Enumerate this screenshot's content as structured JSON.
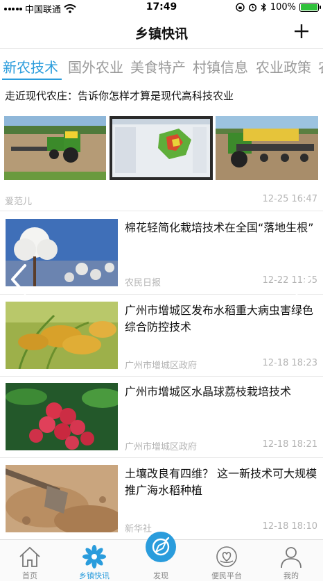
{
  "status_bar": {
    "carrier": "中国联通",
    "time": "17:49",
    "battery": "100%",
    "battery_level": 1.0
  },
  "header": {
    "title": "乡镇快讯",
    "add_icon": "plus-icon"
  },
  "tabs": [
    {
      "label": "新农技术",
      "active": true
    },
    {
      "label": "国外农业",
      "active": false
    },
    {
      "label": "美食特产",
      "active": false
    },
    {
      "label": "村镇信息",
      "active": false
    },
    {
      "label": "农业政策",
      "active": false
    },
    {
      "label": "农",
      "active": false
    }
  ],
  "feature": {
    "title": "走近现代农庄：告诉你怎样才算是现代高科技农业",
    "source": "爱范儿",
    "time": "12-25 16:47"
  },
  "articles": [
    {
      "title": "棉花轻简化栽培技术在全国“落地生根”",
      "source": "农民日报",
      "time": "12-22 11:55"
    },
    {
      "title": "广州市增城区发布水稻重大病虫害绿色综合防控技术",
      "source": "广州市增城区政府",
      "time": "12-18 18:23"
    },
    {
      "title": "广州市增城区水晶球荔枝栽培技术",
      "source": "广州市增城区政府",
      "time": "12-18 18:21"
    },
    {
      "title": "土壤改良有四维？ 这一新技术可大规模推广海水稻种植",
      "source": "新华社",
      "time": "12-18 18:10"
    }
  ],
  "tab_bar": [
    {
      "label": "首页",
      "icon": "home-icon",
      "active": false
    },
    {
      "label": "乡镇快讯",
      "icon": "flower-icon",
      "active": true
    },
    {
      "label": "发现",
      "icon": "compass-icon",
      "active": false
    },
    {
      "label": "便民平台",
      "icon": "heart-hand-icon",
      "active": false
    },
    {
      "label": "我的",
      "icon": "person-icon",
      "active": false
    }
  ],
  "colors": {
    "accent": "#2a9cdc",
    "muted_text": "#b4b4b4",
    "tab_inactive": "#9a9a9a"
  }
}
